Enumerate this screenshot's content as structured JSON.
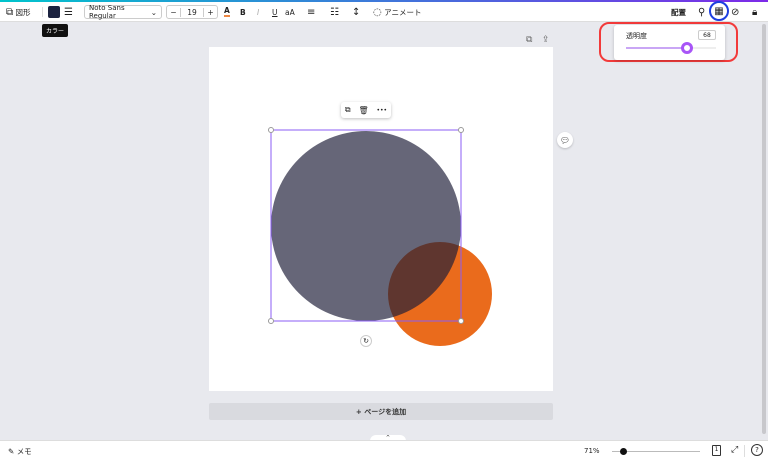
{
  "toolbar": {
    "shape_label": "図形",
    "font": "Noto Sans Regular",
    "font_size": "19",
    "minus": "−",
    "plus": "+",
    "text_color_glyph": "A",
    "bold": "B",
    "italic": "I",
    "underline": "U",
    "case": "aA",
    "animate": "アニメート",
    "position": "配置",
    "color_tooltip": "カラー",
    "fill_color": "#1c2340"
  },
  "transparency": {
    "label": "透明度",
    "value": "68",
    "percent": 68
  },
  "floating": {
    "more": "•••"
  },
  "canvas": {
    "add_page": "+ ページを追加",
    "dark_circle_color": "#1e1e38",
    "orange_circle_color": "#ea6b1c",
    "accent": "#8b5cf6"
  },
  "bottom": {
    "notes": "メモ",
    "zoom": "71%",
    "zoom_percent": 71,
    "page_count": "1",
    "help": "?"
  }
}
